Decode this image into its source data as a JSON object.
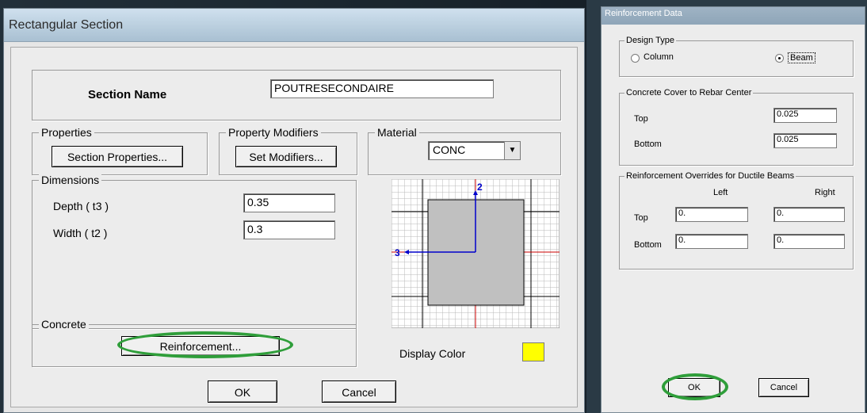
{
  "section_dialog": {
    "title": "Rectangular Section",
    "section_name_label": "Section Name",
    "section_name_value": "POUTRESECONDAIRE",
    "properties_group": "Properties",
    "section_properties_button": "Section Properties...",
    "property_modifiers_group": "Property Modifiers",
    "set_modifiers_button": "Set Modifiers...",
    "material_group": "Material",
    "material_value": "CONC",
    "dimensions_group": "Dimensions",
    "depth_label": "Depth  ( t3 )",
    "depth_value": "0.35",
    "width_label": "Width  ( t2 )",
    "width_value": "0.3",
    "concrete_group": "Concrete",
    "reinforcement_button": "Reinforcement...",
    "display_color_label": "Display Color",
    "display_color": "#ffff00",
    "ok_button": "OK",
    "cancel_button": "Cancel",
    "axis_2_label": "2",
    "axis_3_label": "3"
  },
  "reinforcement_dialog": {
    "title": "Reinforcement Data",
    "design_type_group": "Design Type",
    "column_option": "Column",
    "beam_option": "Beam",
    "selected_design_type": "Beam",
    "cover_group": "Concrete Cover to Rebar Center",
    "top_label": "Top",
    "top_value": "0.025",
    "bottom_label": "Bottom",
    "bottom_value": "0.025",
    "overrides_group": "Reinforcement Overrides for Ductile Beams",
    "left_header": "Left",
    "right_header": "Right",
    "override_top_label": "Top",
    "override_bottom_label": "Bottom",
    "top_left": "0.",
    "top_right": "0.",
    "bottom_left": "0.",
    "bottom_right": "0.",
    "ok_button": "OK",
    "cancel_button": "Cancel"
  },
  "colors": {
    "highlight_ring": "#2f9e3a",
    "axis_blue": "#0000cc",
    "axis_red": "#cc0000"
  }
}
